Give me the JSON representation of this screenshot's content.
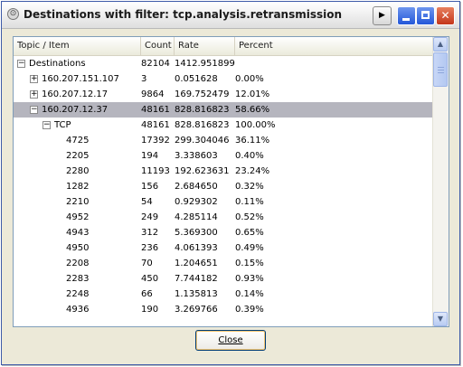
{
  "window": {
    "title": "Destinations with filter: tcp.analysis.retransmission",
    "app_icon": "wireshark-circle-icon",
    "menu_glyph": "▶",
    "close_glyph": "✕"
  },
  "columns": [
    "Topic / Item",
    "Count",
    "Rate",
    "Percent"
  ],
  "rows": [
    {
      "topic": "Destinations",
      "count": "82104",
      "rate": "1412.951899",
      "percent": "",
      "expander": "−",
      "level": 0,
      "selected": false
    },
    {
      "topic": "160.207.151.107",
      "count": "3",
      "rate": "0.051628",
      "percent": "0.00%",
      "expander": "+",
      "level": 1,
      "selected": false
    },
    {
      "topic": "160.207.12.17",
      "count": "9864",
      "rate": "169.752479",
      "percent": "12.01%",
      "expander": "+",
      "level": 1,
      "selected": false
    },
    {
      "topic": "160.207.12.37",
      "count": "48161",
      "rate": "828.816823",
      "percent": "58.66%",
      "expander": "−",
      "level": 1,
      "selected": true
    },
    {
      "topic": "TCP",
      "count": "48161",
      "rate": "828.816823",
      "percent": "100.00%",
      "expander": "−",
      "level": 2,
      "selected": false
    },
    {
      "topic": "4725",
      "count": "17392",
      "rate": "299.304046",
      "percent": "36.11%",
      "expander": "",
      "level": 3,
      "selected": false
    },
    {
      "topic": "2205",
      "count": "194",
      "rate": "3.338603",
      "percent": "0.40%",
      "expander": "",
      "level": 3,
      "selected": false
    },
    {
      "topic": "2280",
      "count": "11193",
      "rate": "192.623631",
      "percent": "23.24%",
      "expander": "",
      "level": 3,
      "selected": false
    },
    {
      "topic": "1282",
      "count": "156",
      "rate": "2.684650",
      "percent": "0.32%",
      "expander": "",
      "level": 3,
      "selected": false
    },
    {
      "topic": "2210",
      "count": "54",
      "rate": "0.929302",
      "percent": "0.11%",
      "expander": "",
      "level": 3,
      "selected": false
    },
    {
      "topic": "4952",
      "count": "249",
      "rate": "4.285114",
      "percent": "0.52%",
      "expander": "",
      "level": 3,
      "selected": false
    },
    {
      "topic": "4943",
      "count": "312",
      "rate": "5.369300",
      "percent": "0.65%",
      "expander": "",
      "level": 3,
      "selected": false
    },
    {
      "topic": "4950",
      "count": "236",
      "rate": "4.061393",
      "percent": "0.49%",
      "expander": "",
      "level": 3,
      "selected": false
    },
    {
      "topic": "2208",
      "count": "70",
      "rate": "1.204651",
      "percent": "0.15%",
      "expander": "",
      "level": 3,
      "selected": false
    },
    {
      "topic": "2283",
      "count": "450",
      "rate": "7.744182",
      "percent": "0.93%",
      "expander": "",
      "level": 3,
      "selected": false
    },
    {
      "topic": "2248",
      "count": "66",
      "rate": "1.135813",
      "percent": "0.14%",
      "expander": "",
      "level": 3,
      "selected": false
    },
    {
      "topic": "4936",
      "count": "190",
      "rate": "3.269766",
      "percent": "0.39%",
      "expander": "",
      "level": 3,
      "selected": false
    }
  ],
  "scrollbar": {
    "up_glyph": "▲",
    "down_glyph": "▼"
  },
  "buttons": {
    "close_label": "Close"
  },
  "colors": {
    "selection": "#b5b5be",
    "accent_border": "#7f9db9"
  }
}
